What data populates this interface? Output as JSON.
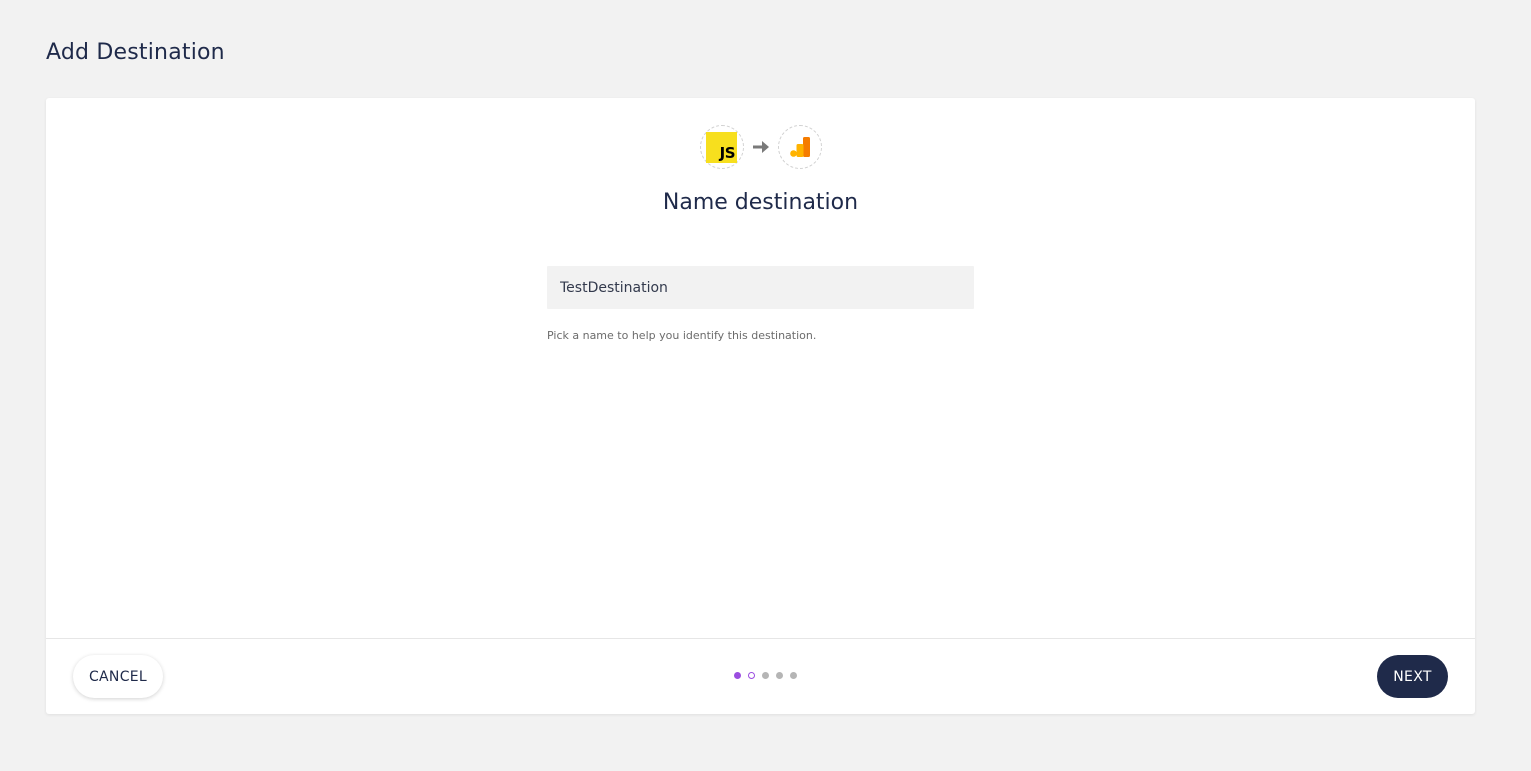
{
  "page": {
    "title": "Add Destination"
  },
  "wizard": {
    "source_logo_text": "JS",
    "step_title": "Name destination",
    "name_input": {
      "value": "TestDestination",
      "placeholder": ""
    },
    "helper_text": "Pick a name to help you identify this destination.",
    "steps": [
      {
        "state": "done"
      },
      {
        "state": "current"
      },
      {
        "state": "todo"
      },
      {
        "state": "todo"
      },
      {
        "state": "todo"
      }
    ]
  },
  "footer": {
    "cancel_label": "CANCEL",
    "next_label": "NEXT"
  },
  "icons": {
    "source": "javascript-icon",
    "arrow": "arrow-right-icon",
    "destination": "google-analytics-icon"
  },
  "colors": {
    "primary": "#1f2a4a",
    "accent": "#9b4de0",
    "js_yellow": "#f7df1e",
    "ga_orange": "#f57c00",
    "ga_yellow": "#ffb300"
  }
}
